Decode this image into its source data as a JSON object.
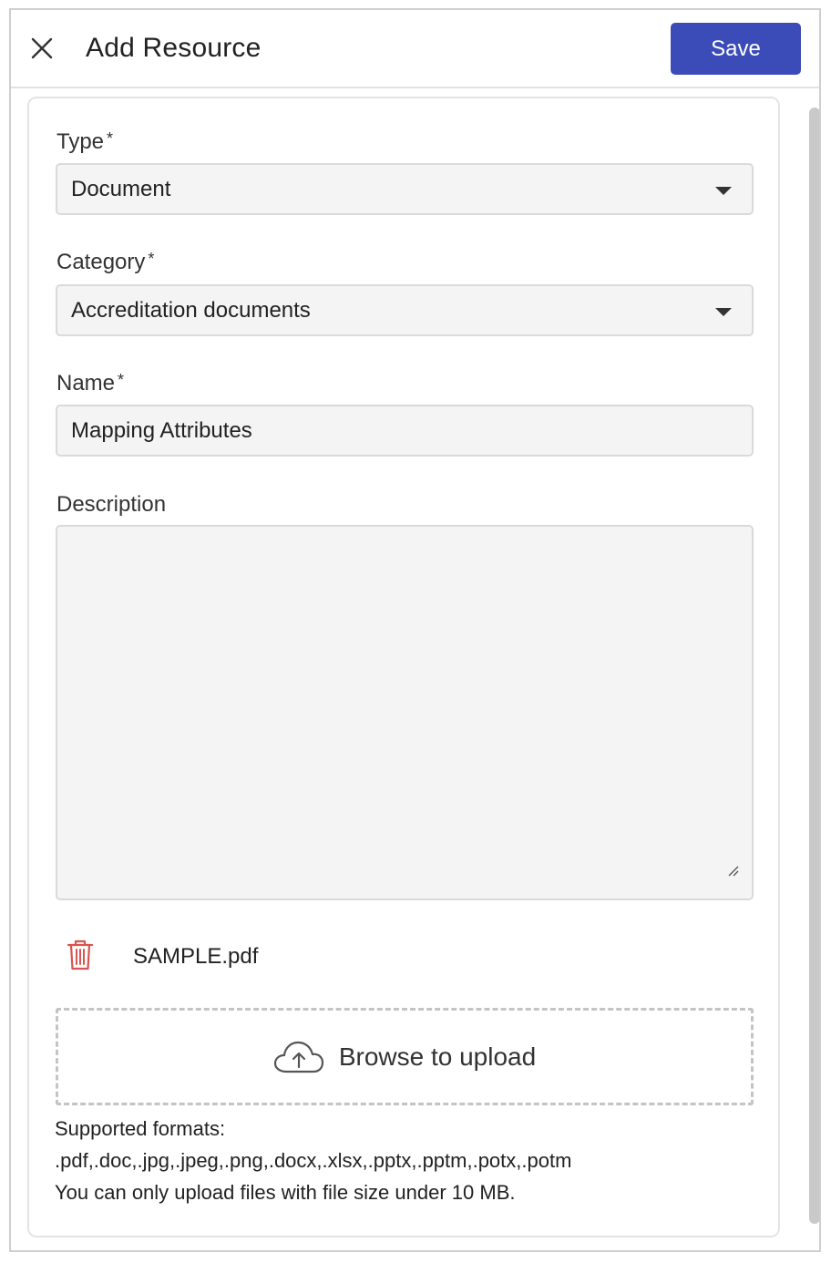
{
  "header": {
    "title": "Add Resource",
    "save_label": "Save"
  },
  "form": {
    "type": {
      "label": "Type",
      "required_mark": "*",
      "value": "Document"
    },
    "category": {
      "label": "Category",
      "required_mark": "*",
      "value": "Accreditation documents"
    },
    "name": {
      "label": "Name",
      "required_mark": "*",
      "value": "Mapping Attributes"
    },
    "description": {
      "label": "Description",
      "value": ""
    }
  },
  "attachment": {
    "file_name": "SAMPLE.pdf"
  },
  "upload": {
    "label": "Browse to upload",
    "formats_title": "Supported formats:",
    "formats_list": ".pdf,.doc,.jpg,.jpeg,.png,.docx,.xlsx,.pptx,.pptm,.potx,.potm",
    "size_note": "You can only upload files with file size under 10 MB."
  },
  "icons": {
    "close": "close-icon",
    "dropdown": "caret-down-icon",
    "delete": "trash-icon",
    "upload": "cloud-upload-icon",
    "resize": "resize-handle-icon"
  },
  "colors": {
    "primary": "#3b4cb8",
    "danger": "#d9534f",
    "field_bg": "#f4f4f4"
  }
}
